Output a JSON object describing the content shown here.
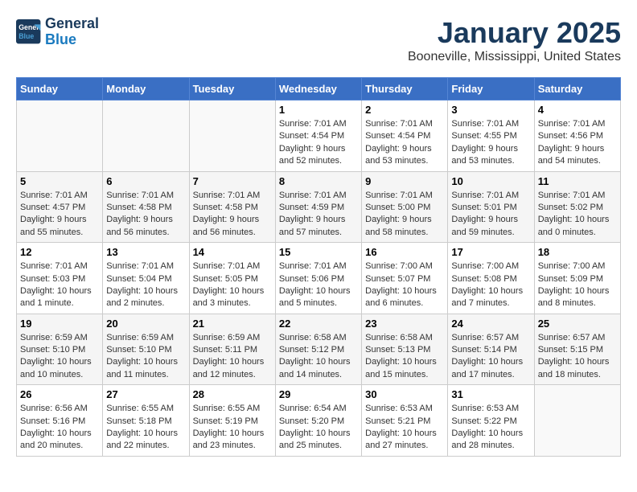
{
  "header": {
    "logo_line1": "General",
    "logo_line2": "Blue",
    "month": "January 2025",
    "location": "Booneville, Mississippi, United States"
  },
  "weekdays": [
    "Sunday",
    "Monday",
    "Tuesday",
    "Wednesday",
    "Thursday",
    "Friday",
    "Saturday"
  ],
  "weeks": [
    [
      {
        "day": "",
        "text": ""
      },
      {
        "day": "",
        "text": ""
      },
      {
        "day": "",
        "text": ""
      },
      {
        "day": "1",
        "text": "Sunrise: 7:01 AM\nSunset: 4:54 PM\nDaylight: 9 hours and 52 minutes."
      },
      {
        "day": "2",
        "text": "Sunrise: 7:01 AM\nSunset: 4:54 PM\nDaylight: 9 hours and 53 minutes."
      },
      {
        "day": "3",
        "text": "Sunrise: 7:01 AM\nSunset: 4:55 PM\nDaylight: 9 hours and 53 minutes."
      },
      {
        "day": "4",
        "text": "Sunrise: 7:01 AM\nSunset: 4:56 PM\nDaylight: 9 hours and 54 minutes."
      }
    ],
    [
      {
        "day": "5",
        "text": "Sunrise: 7:01 AM\nSunset: 4:57 PM\nDaylight: 9 hours and 55 minutes."
      },
      {
        "day": "6",
        "text": "Sunrise: 7:01 AM\nSunset: 4:58 PM\nDaylight: 9 hours and 56 minutes."
      },
      {
        "day": "7",
        "text": "Sunrise: 7:01 AM\nSunset: 4:58 PM\nDaylight: 9 hours and 56 minutes."
      },
      {
        "day": "8",
        "text": "Sunrise: 7:01 AM\nSunset: 4:59 PM\nDaylight: 9 hours and 57 minutes."
      },
      {
        "day": "9",
        "text": "Sunrise: 7:01 AM\nSunset: 5:00 PM\nDaylight: 9 hours and 58 minutes."
      },
      {
        "day": "10",
        "text": "Sunrise: 7:01 AM\nSunset: 5:01 PM\nDaylight: 9 hours and 59 minutes."
      },
      {
        "day": "11",
        "text": "Sunrise: 7:01 AM\nSunset: 5:02 PM\nDaylight: 10 hours and 0 minutes."
      }
    ],
    [
      {
        "day": "12",
        "text": "Sunrise: 7:01 AM\nSunset: 5:03 PM\nDaylight: 10 hours and 1 minute."
      },
      {
        "day": "13",
        "text": "Sunrise: 7:01 AM\nSunset: 5:04 PM\nDaylight: 10 hours and 2 minutes."
      },
      {
        "day": "14",
        "text": "Sunrise: 7:01 AM\nSunset: 5:05 PM\nDaylight: 10 hours and 3 minutes."
      },
      {
        "day": "15",
        "text": "Sunrise: 7:01 AM\nSunset: 5:06 PM\nDaylight: 10 hours and 5 minutes."
      },
      {
        "day": "16",
        "text": "Sunrise: 7:00 AM\nSunset: 5:07 PM\nDaylight: 10 hours and 6 minutes."
      },
      {
        "day": "17",
        "text": "Sunrise: 7:00 AM\nSunset: 5:08 PM\nDaylight: 10 hours and 7 minutes."
      },
      {
        "day": "18",
        "text": "Sunrise: 7:00 AM\nSunset: 5:09 PM\nDaylight: 10 hours and 8 minutes."
      }
    ],
    [
      {
        "day": "19",
        "text": "Sunrise: 6:59 AM\nSunset: 5:10 PM\nDaylight: 10 hours and 10 minutes."
      },
      {
        "day": "20",
        "text": "Sunrise: 6:59 AM\nSunset: 5:10 PM\nDaylight: 10 hours and 11 minutes."
      },
      {
        "day": "21",
        "text": "Sunrise: 6:59 AM\nSunset: 5:11 PM\nDaylight: 10 hours and 12 minutes."
      },
      {
        "day": "22",
        "text": "Sunrise: 6:58 AM\nSunset: 5:12 PM\nDaylight: 10 hours and 14 minutes."
      },
      {
        "day": "23",
        "text": "Sunrise: 6:58 AM\nSunset: 5:13 PM\nDaylight: 10 hours and 15 minutes."
      },
      {
        "day": "24",
        "text": "Sunrise: 6:57 AM\nSunset: 5:14 PM\nDaylight: 10 hours and 17 minutes."
      },
      {
        "day": "25",
        "text": "Sunrise: 6:57 AM\nSunset: 5:15 PM\nDaylight: 10 hours and 18 minutes."
      }
    ],
    [
      {
        "day": "26",
        "text": "Sunrise: 6:56 AM\nSunset: 5:16 PM\nDaylight: 10 hours and 20 minutes."
      },
      {
        "day": "27",
        "text": "Sunrise: 6:55 AM\nSunset: 5:18 PM\nDaylight: 10 hours and 22 minutes."
      },
      {
        "day": "28",
        "text": "Sunrise: 6:55 AM\nSunset: 5:19 PM\nDaylight: 10 hours and 23 minutes."
      },
      {
        "day": "29",
        "text": "Sunrise: 6:54 AM\nSunset: 5:20 PM\nDaylight: 10 hours and 25 minutes."
      },
      {
        "day": "30",
        "text": "Sunrise: 6:53 AM\nSunset: 5:21 PM\nDaylight: 10 hours and 27 minutes."
      },
      {
        "day": "31",
        "text": "Sunrise: 6:53 AM\nSunset: 5:22 PM\nDaylight: 10 hours and 28 minutes."
      },
      {
        "day": "",
        "text": ""
      }
    ]
  ]
}
